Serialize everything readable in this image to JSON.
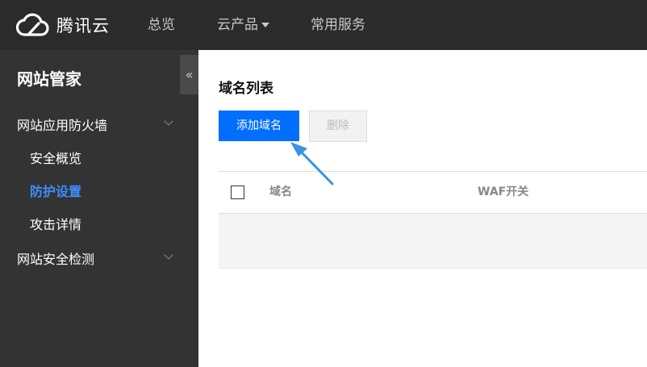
{
  "header": {
    "brand": "腾讯云",
    "nav": {
      "overview": "总览",
      "products": "云产品",
      "services": "常用服务"
    }
  },
  "sidebar": {
    "title": "网站管家",
    "collapse_glyph": "«",
    "groups": [
      {
        "label": "网站应用防火墙",
        "items": [
          "安全概览",
          "防护设置",
          "攻击详情"
        ]
      },
      {
        "label": "网站安全检测"
      }
    ]
  },
  "main": {
    "title": "域名列表",
    "add_button": "添加域名",
    "delete_button": "删除",
    "table": {
      "headers": [
        "域名",
        "WAF开关"
      ]
    }
  },
  "colors": {
    "topbar_bg": "#2b2b2b",
    "sidebar_bg": "#333333",
    "accent_blue": "#006eff",
    "active_link": "#3b8fff",
    "annotation_arrow": "#3a93e0"
  },
  "icons": {
    "logo": "cloud-logo-icon",
    "dropdown": "caret-down-icon",
    "collapse": "double-chevron-left-icon",
    "group_toggle": "chevron-down-icon"
  }
}
